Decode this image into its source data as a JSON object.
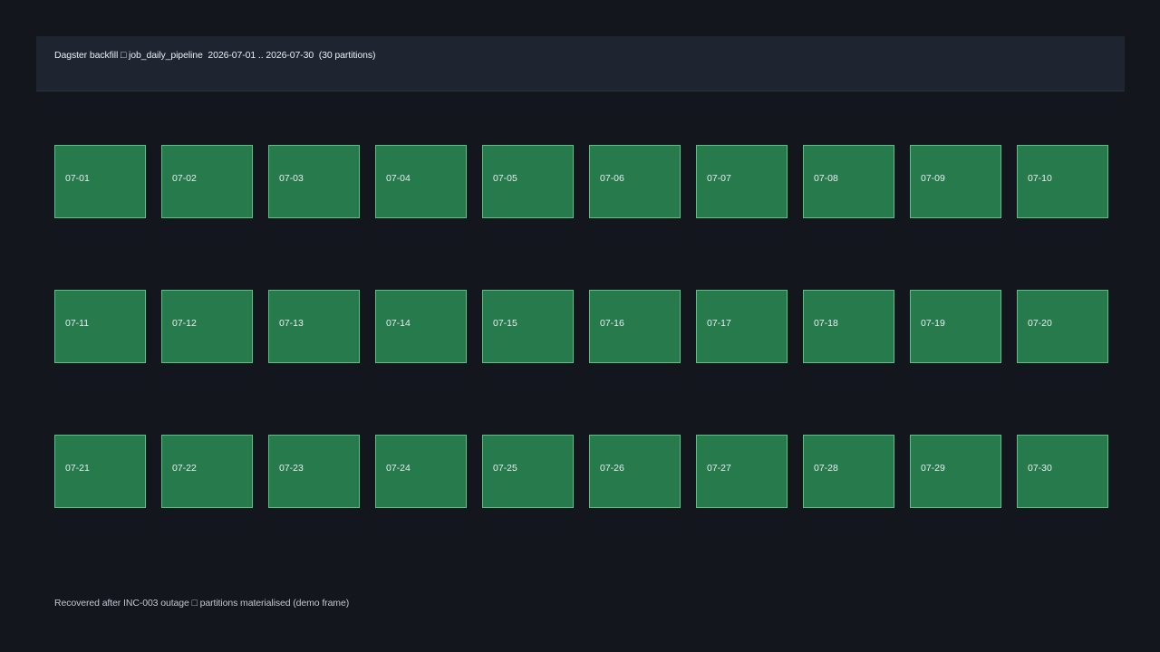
{
  "header": {
    "title": "Dagster backfill □ job_daily_pipeline  2026-07-01 .. 2026-07-30  (30 partitions)"
  },
  "partitions": [
    {
      "label": "07-01",
      "status": "materialized"
    },
    {
      "label": "07-02",
      "status": "materialized"
    },
    {
      "label": "07-03",
      "status": "materialized"
    },
    {
      "label": "07-04",
      "status": "materialized"
    },
    {
      "label": "07-05",
      "status": "materialized"
    },
    {
      "label": "07-06",
      "status": "materialized"
    },
    {
      "label": "07-07",
      "status": "materialized"
    },
    {
      "label": "07-08",
      "status": "materialized"
    },
    {
      "label": "07-09",
      "status": "materialized"
    },
    {
      "label": "07-10",
      "status": "materialized"
    },
    {
      "label": "07-11",
      "status": "materialized"
    },
    {
      "label": "07-12",
      "status": "materialized"
    },
    {
      "label": "07-13",
      "status": "materialized"
    },
    {
      "label": "07-14",
      "status": "materialized"
    },
    {
      "label": "07-15",
      "status": "materialized"
    },
    {
      "label": "07-16",
      "status": "materialized"
    },
    {
      "label": "07-17",
      "status": "materialized"
    },
    {
      "label": "07-18",
      "status": "materialized"
    },
    {
      "label": "07-19",
      "status": "materialized"
    },
    {
      "label": "07-20",
      "status": "materialized"
    },
    {
      "label": "07-21",
      "status": "materialized"
    },
    {
      "label": "07-22",
      "status": "materialized"
    },
    {
      "label": "07-23",
      "status": "materialized"
    },
    {
      "label": "07-24",
      "status": "materialized"
    },
    {
      "label": "07-25",
      "status": "materialized"
    },
    {
      "label": "07-26",
      "status": "materialized"
    },
    {
      "label": "07-27",
      "status": "materialized"
    },
    {
      "label": "07-28",
      "status": "materialized"
    },
    {
      "label": "07-29",
      "status": "materialized"
    },
    {
      "label": "07-30",
      "status": "materialized"
    }
  ],
  "colors": {
    "background": "#13161c",
    "header_background": "#1f2530",
    "tile_fill": "#277a4b",
    "tile_border": "#59c283",
    "text": "#e6edf3"
  },
  "footer": {
    "text": "Recovered after INC-003 outage □ partitions materialised (demo frame)"
  }
}
